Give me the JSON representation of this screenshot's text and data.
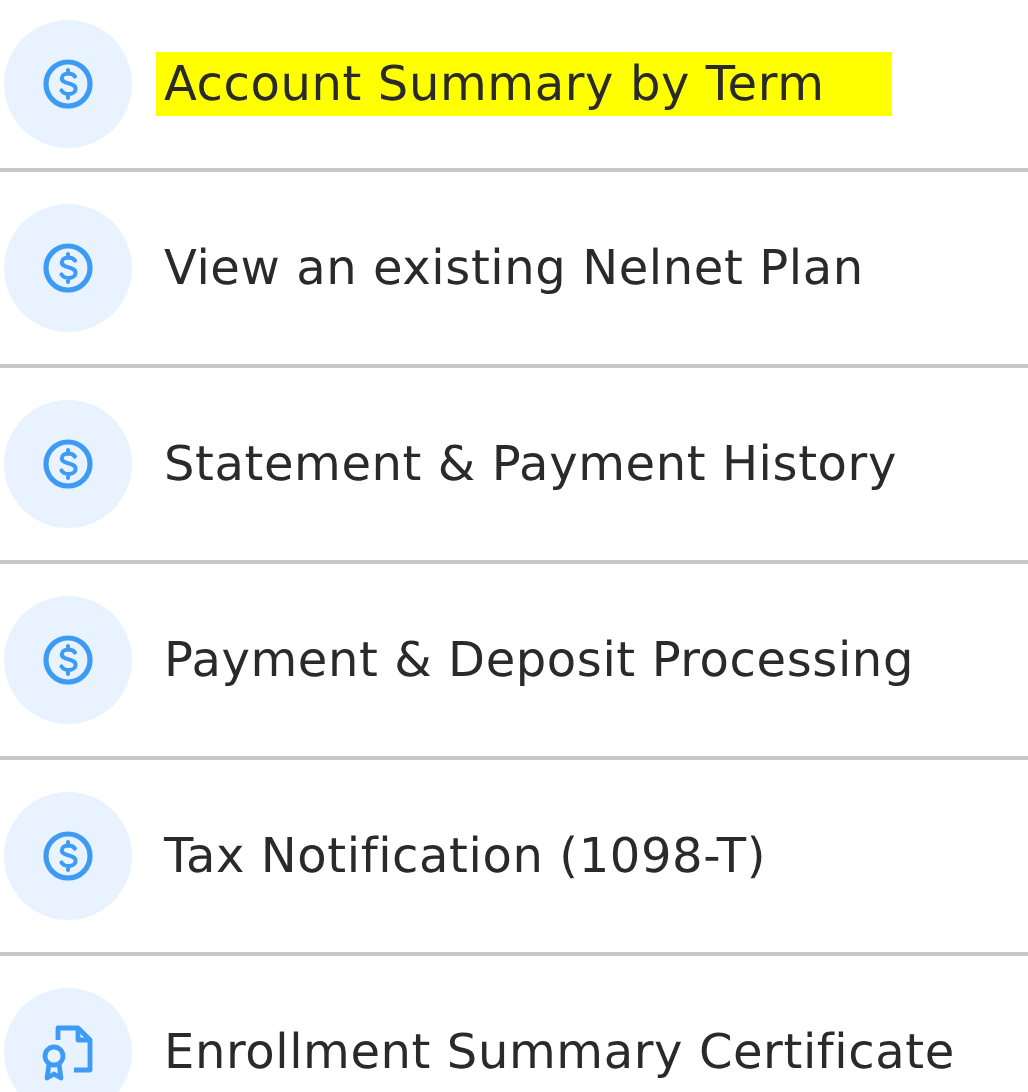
{
  "menu_items": [
    {
      "label": "Account Summary by Term",
      "kind": "dollar",
      "highlighted": true
    },
    {
      "label": "View an existing Nelnet Plan",
      "kind": "dollar",
      "highlighted": false
    },
    {
      "label": "Statement & Payment History",
      "kind": "dollar",
      "highlighted": false
    },
    {
      "label": "Payment & Deposit Processing",
      "kind": "dollar",
      "highlighted": false
    },
    {
      "label": "Tax Notification (1098-T)",
      "kind": "dollar",
      "highlighted": false
    },
    {
      "label": "Enrollment Summary Certificate",
      "kind": "certificate",
      "highlighted": false
    }
  ]
}
